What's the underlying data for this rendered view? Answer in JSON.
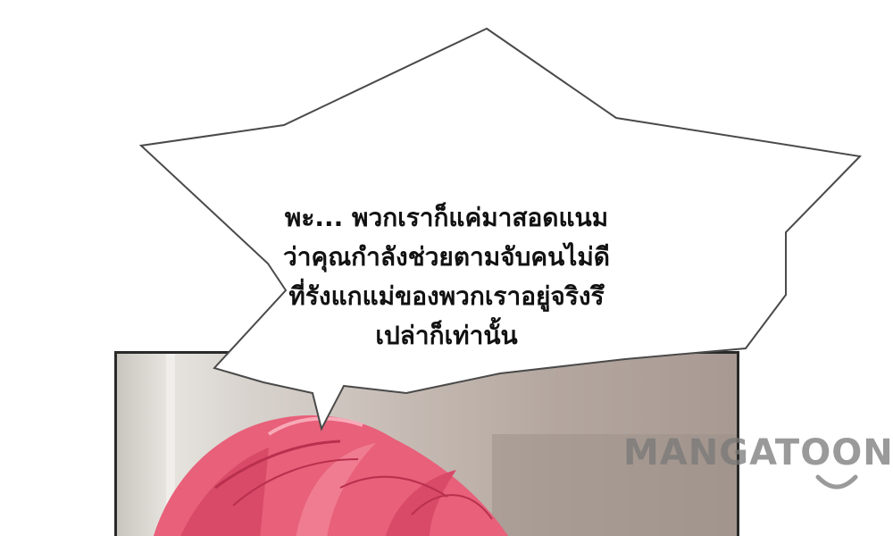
{
  "speech_bubble": {
    "text": "พะ... พวกเราก็แค่มาสอดแนม\nว่าคุณกำลังช่วยตามจับคนไม่ดี\nที่รังแกแม่ของพวกเราอยู่จริงรึ\nเปล่าก็เท่านั้น"
  },
  "watermark": {
    "text": "MANGATOON"
  },
  "colors": {
    "hair": "#e8607a",
    "hair_dark": "#b9304f",
    "panel_border": "#2a2a2a",
    "watermark": "#787878"
  }
}
